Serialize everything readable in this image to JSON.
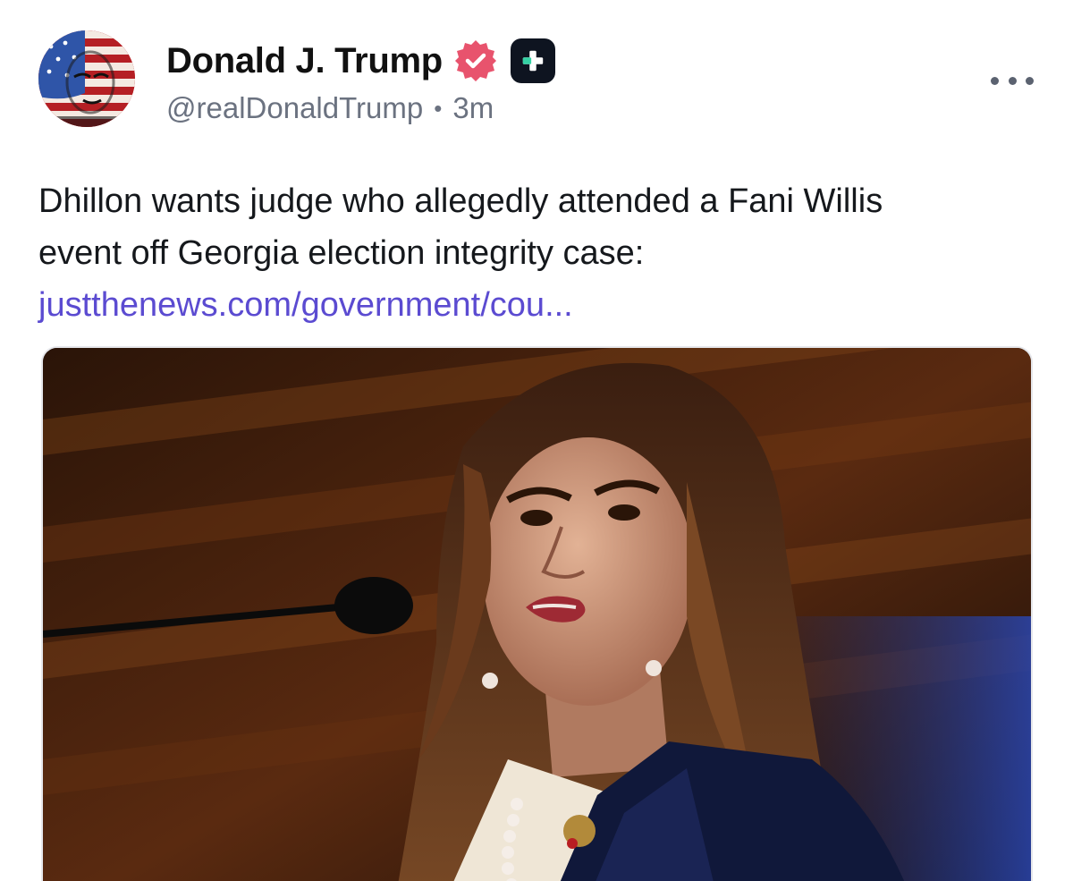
{
  "post": {
    "author": {
      "display_name": "Donald J. Trump",
      "handle": "@realDonaldTrump",
      "verified_icon": "verified-badge-icon",
      "plus_icon": "plus-badge-icon"
    },
    "timestamp": "3m",
    "separator": "•",
    "text_line_1": "Dhillon wants judge who allegedly attended a Fani Willis",
    "text_line_2": "event off Georgia election integrity case:",
    "link_text": "justthenews.com/government/cou...",
    "more_icon": "more-options-icon",
    "media": {
      "alt": "Woman with long brown hair speaking into a microphone, wearing a dark sparkly blazer and pearl necklace"
    }
  },
  "colors": {
    "verified_badge": "#e8536d",
    "link": "#5b4bd1",
    "handle_text": "#6b7280",
    "plus_badge_bg": "#0e1420",
    "plus_badge_cross": "#35d1a4"
  }
}
